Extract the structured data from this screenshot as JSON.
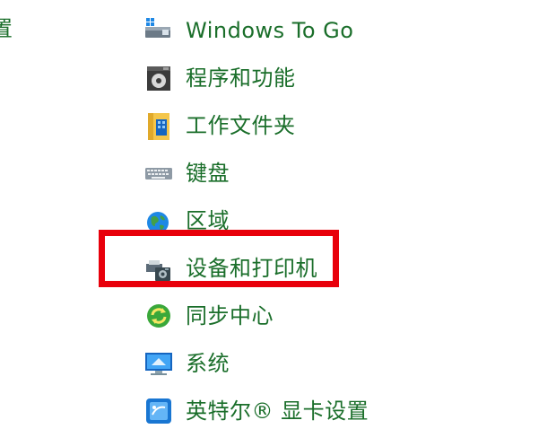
{
  "left_fragment": "置",
  "items": [
    {
      "label": "Windows To Go",
      "icon": "windows-to-go-icon"
    },
    {
      "label": "程序和功能",
      "icon": "programs-features-icon"
    },
    {
      "label": "工作文件夹",
      "icon": "work-folders-icon"
    },
    {
      "label": "键盘",
      "icon": "keyboard-icon"
    },
    {
      "label": "区域",
      "icon": "region-globe-icon"
    },
    {
      "label": "设备和打印机",
      "icon": "devices-printers-icon"
    },
    {
      "label": "同步中心",
      "icon": "sync-center-icon"
    },
    {
      "label": "系统",
      "icon": "system-monitor-icon"
    },
    {
      "label": "英特尔® 显卡设置",
      "icon": "intel-graphics-icon"
    }
  ],
  "colors": {
    "link_text": "#1a6e2a",
    "highlight": "#e8000b",
    "background": "#ffffff"
  }
}
